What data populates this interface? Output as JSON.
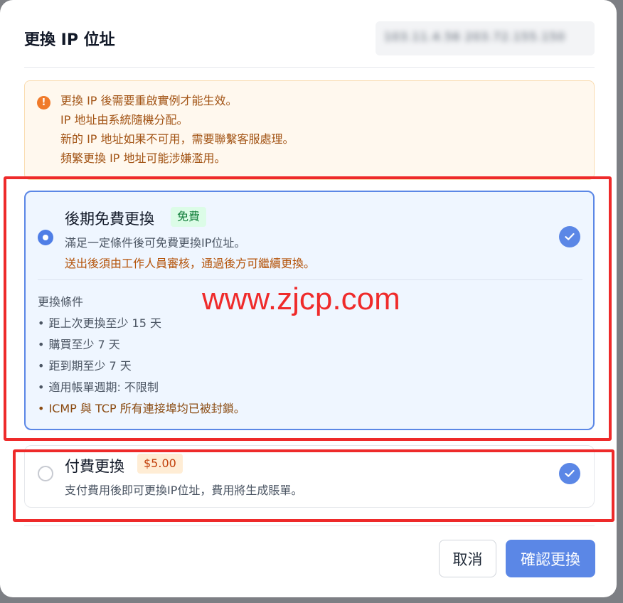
{
  "dialog": {
    "title": "更換 IP 位址",
    "ip_display": "103.11.4.56 203.72.155.150"
  },
  "notice": {
    "icon": "exclamation-icon",
    "lines": [
      "更換 IP 後需要重啟實例才能生效。",
      "IP 地址由系統隨機分配。",
      "新的 IP 地址如果不可用，需要聯繫客服處理。",
      "頻繁更換 IP 地址可能涉嫌濫用。"
    ]
  },
  "options": [
    {
      "title": "後期免費更換",
      "badge": "免費",
      "description": "滿足一定條件後可免費更換IP位址。",
      "note": "送出後須由工作人員審核，通過後方可繼續更換。",
      "conditions_title": "更換條件",
      "conditions": [
        "距上次更換至少 15 天",
        "購買至少 7 天",
        "距到期至少 7 天",
        "適用帳單週期: 不限制",
        "ICMP 與 TCP 所有連接埠均已被封鎖。"
      ],
      "bullet": "•",
      "selected": true
    },
    {
      "title": "付費更換",
      "badge": "$5.00",
      "description": "支付費用後即可更換IP位址，費用將生成賬單。",
      "selected": false
    }
  ],
  "footer": {
    "cancel_label": "取消",
    "confirm_label": "確認更換"
  },
  "watermark": "www.zjcp.com",
  "colors": {
    "accent": "#5b87e6",
    "notice_text": "#a25314",
    "highlight_box": "#ee2a2a"
  }
}
